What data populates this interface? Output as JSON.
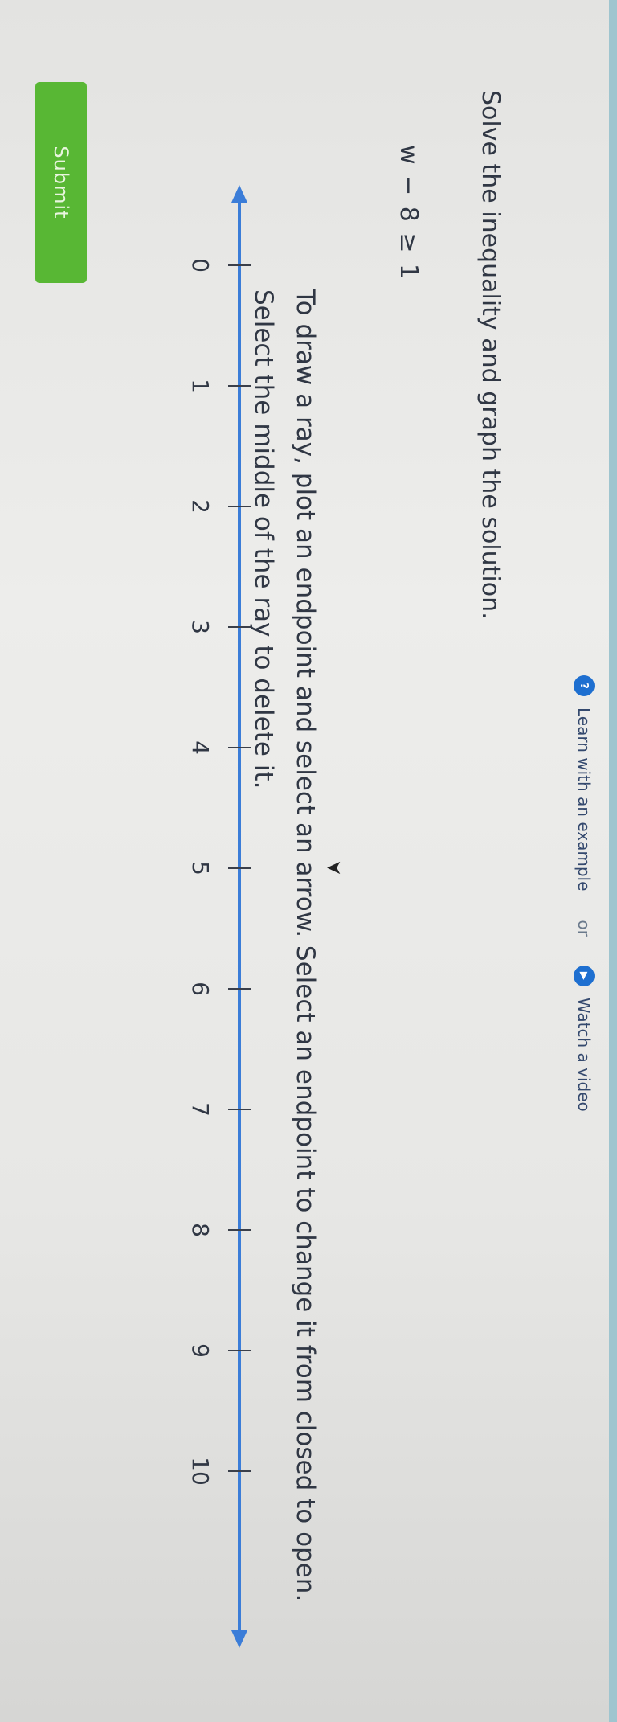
{
  "toolbar": {
    "example_label": "Learn with an example",
    "or_label": "or",
    "video_label": "Watch a video"
  },
  "question": {
    "prompt": "Solve the inequality and graph the solution.",
    "equation": "w − 8 ≥ 1",
    "instructions": "To draw a ray, plot an endpoint and select an arrow. Select an endpoint to change it from closed to open. Select the middle of the ray to delete it."
  },
  "number_line": {
    "min": 0,
    "max": 10,
    "ticks": [
      0,
      1,
      2,
      3,
      4,
      5,
      6,
      7,
      8,
      9,
      10
    ],
    "tick_labels": [
      "0",
      "1",
      "2",
      "3",
      "4",
      "5",
      "6",
      "7",
      "8",
      "9",
      "10"
    ],
    "arrows": "both ends",
    "line_color": "#3b7dd8"
  },
  "submit_label": "Submit",
  "colors": {
    "accent": "#1e6fd0",
    "submit": "#58b734",
    "text": "#303744"
  }
}
